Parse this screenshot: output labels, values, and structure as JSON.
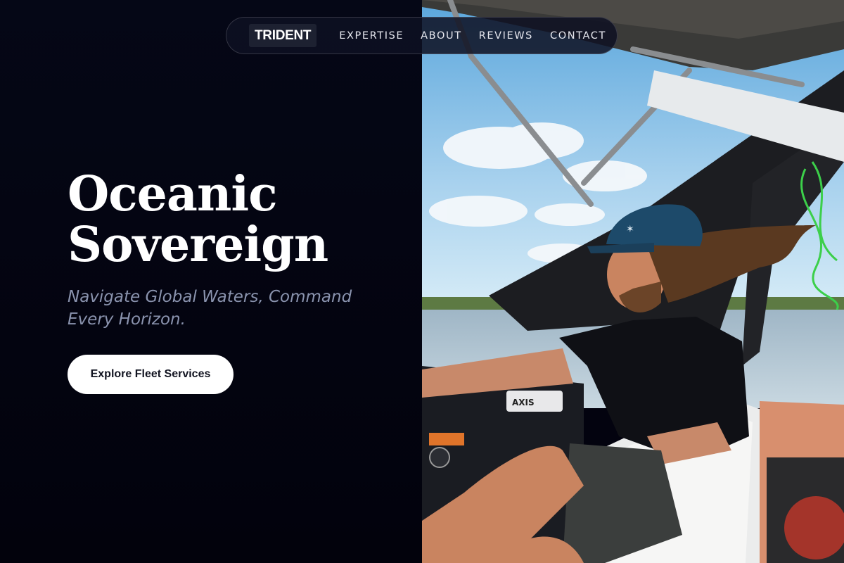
{
  "nav": {
    "logo": "TRIDENT",
    "links": [
      {
        "label": "EXPERTISE"
      },
      {
        "label": "ABOUT"
      },
      {
        "label": "REVIEWS"
      },
      {
        "label": "CONTACT"
      }
    ]
  },
  "hero": {
    "title_line1": "Oceanic",
    "title_line2": "Sovereign",
    "subtitle_line1": "Navigate Global Waters, Command",
    "subtitle_line2": "Every Horizon.",
    "cta_label": "Explore Fleet Services"
  },
  "photo": {
    "description_icon": "wakeboard-boat-photo",
    "boat_brand": "AXIS"
  },
  "colors": {
    "background": "#03030f",
    "nav_bg": "#0e1022",
    "heading": "#ffffff",
    "subtitle": "#8a93ae",
    "cta_bg": "#ffffff",
    "cta_text": "#111320"
  }
}
